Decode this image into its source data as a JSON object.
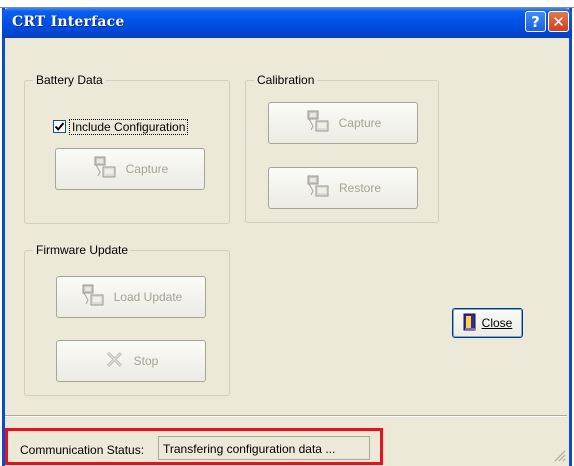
{
  "window": {
    "title": "CRT Interface",
    "help_label": "?",
    "close_label": "✕"
  },
  "battery": {
    "group_label": "Battery Data",
    "checkbox_label": "Include Configuration",
    "checkbox_checked": true,
    "capture_label": "Capture"
  },
  "calibration": {
    "group_label": "Calibration",
    "capture_label": "Capture",
    "restore_label": "Restore"
  },
  "firmware": {
    "group_label": "Firmware Update",
    "load_label": "Load Update",
    "stop_label": "Stop"
  },
  "close_button": {
    "label": "Close",
    "mnemonic": "C"
  },
  "status": {
    "label": "Communication Status:",
    "value": "Transfering configuration data ..."
  },
  "colors": {
    "titlebar": "#0052e6",
    "face": "#ece9d8",
    "disabled_text": "#a5a396",
    "highlight": "#e8101a"
  },
  "icons": {
    "capture": "device-capture-icon",
    "restore": "device-restore-icon",
    "load": "device-load-icon",
    "stop": "stop-x-icon",
    "close": "door-exit-icon"
  }
}
